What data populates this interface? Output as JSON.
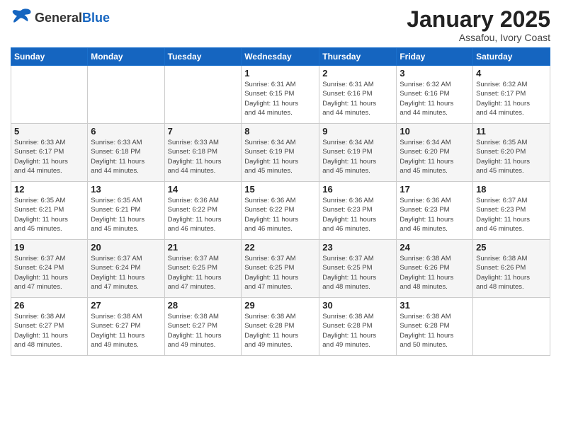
{
  "header": {
    "logo_general": "General",
    "logo_blue": "Blue",
    "month_title": "January 2025",
    "location": "Assafou, Ivory Coast"
  },
  "weekdays": [
    "Sunday",
    "Monday",
    "Tuesday",
    "Wednesday",
    "Thursday",
    "Friday",
    "Saturday"
  ],
  "weeks": [
    [
      {
        "day": "",
        "info": ""
      },
      {
        "day": "",
        "info": ""
      },
      {
        "day": "",
        "info": ""
      },
      {
        "day": "1",
        "info": "Sunrise: 6:31 AM\nSunset: 6:15 PM\nDaylight: 11 hours\nand 44 minutes."
      },
      {
        "day": "2",
        "info": "Sunrise: 6:31 AM\nSunset: 6:16 PM\nDaylight: 11 hours\nand 44 minutes."
      },
      {
        "day": "3",
        "info": "Sunrise: 6:32 AM\nSunset: 6:16 PM\nDaylight: 11 hours\nand 44 minutes."
      },
      {
        "day": "4",
        "info": "Sunrise: 6:32 AM\nSunset: 6:17 PM\nDaylight: 11 hours\nand 44 minutes."
      }
    ],
    [
      {
        "day": "5",
        "info": "Sunrise: 6:33 AM\nSunset: 6:17 PM\nDaylight: 11 hours\nand 44 minutes."
      },
      {
        "day": "6",
        "info": "Sunrise: 6:33 AM\nSunset: 6:18 PM\nDaylight: 11 hours\nand 44 minutes."
      },
      {
        "day": "7",
        "info": "Sunrise: 6:33 AM\nSunset: 6:18 PM\nDaylight: 11 hours\nand 44 minutes."
      },
      {
        "day": "8",
        "info": "Sunrise: 6:34 AM\nSunset: 6:19 PM\nDaylight: 11 hours\nand 45 minutes."
      },
      {
        "day": "9",
        "info": "Sunrise: 6:34 AM\nSunset: 6:19 PM\nDaylight: 11 hours\nand 45 minutes."
      },
      {
        "day": "10",
        "info": "Sunrise: 6:34 AM\nSunset: 6:20 PM\nDaylight: 11 hours\nand 45 minutes."
      },
      {
        "day": "11",
        "info": "Sunrise: 6:35 AM\nSunset: 6:20 PM\nDaylight: 11 hours\nand 45 minutes."
      }
    ],
    [
      {
        "day": "12",
        "info": "Sunrise: 6:35 AM\nSunset: 6:21 PM\nDaylight: 11 hours\nand 45 minutes."
      },
      {
        "day": "13",
        "info": "Sunrise: 6:35 AM\nSunset: 6:21 PM\nDaylight: 11 hours\nand 45 minutes."
      },
      {
        "day": "14",
        "info": "Sunrise: 6:36 AM\nSunset: 6:22 PM\nDaylight: 11 hours\nand 46 minutes."
      },
      {
        "day": "15",
        "info": "Sunrise: 6:36 AM\nSunset: 6:22 PM\nDaylight: 11 hours\nand 46 minutes."
      },
      {
        "day": "16",
        "info": "Sunrise: 6:36 AM\nSunset: 6:23 PM\nDaylight: 11 hours\nand 46 minutes."
      },
      {
        "day": "17",
        "info": "Sunrise: 6:36 AM\nSunset: 6:23 PM\nDaylight: 11 hours\nand 46 minutes."
      },
      {
        "day": "18",
        "info": "Sunrise: 6:37 AM\nSunset: 6:23 PM\nDaylight: 11 hours\nand 46 minutes."
      }
    ],
    [
      {
        "day": "19",
        "info": "Sunrise: 6:37 AM\nSunset: 6:24 PM\nDaylight: 11 hours\nand 47 minutes."
      },
      {
        "day": "20",
        "info": "Sunrise: 6:37 AM\nSunset: 6:24 PM\nDaylight: 11 hours\nand 47 minutes."
      },
      {
        "day": "21",
        "info": "Sunrise: 6:37 AM\nSunset: 6:25 PM\nDaylight: 11 hours\nand 47 minutes."
      },
      {
        "day": "22",
        "info": "Sunrise: 6:37 AM\nSunset: 6:25 PM\nDaylight: 11 hours\nand 47 minutes."
      },
      {
        "day": "23",
        "info": "Sunrise: 6:37 AM\nSunset: 6:25 PM\nDaylight: 11 hours\nand 48 minutes."
      },
      {
        "day": "24",
        "info": "Sunrise: 6:38 AM\nSunset: 6:26 PM\nDaylight: 11 hours\nand 48 minutes."
      },
      {
        "day": "25",
        "info": "Sunrise: 6:38 AM\nSunset: 6:26 PM\nDaylight: 11 hours\nand 48 minutes."
      }
    ],
    [
      {
        "day": "26",
        "info": "Sunrise: 6:38 AM\nSunset: 6:27 PM\nDaylight: 11 hours\nand 48 minutes."
      },
      {
        "day": "27",
        "info": "Sunrise: 6:38 AM\nSunset: 6:27 PM\nDaylight: 11 hours\nand 49 minutes."
      },
      {
        "day": "28",
        "info": "Sunrise: 6:38 AM\nSunset: 6:27 PM\nDaylight: 11 hours\nand 49 minutes."
      },
      {
        "day": "29",
        "info": "Sunrise: 6:38 AM\nSunset: 6:28 PM\nDaylight: 11 hours\nand 49 minutes."
      },
      {
        "day": "30",
        "info": "Sunrise: 6:38 AM\nSunset: 6:28 PM\nDaylight: 11 hours\nand 49 minutes."
      },
      {
        "day": "31",
        "info": "Sunrise: 6:38 AM\nSunset: 6:28 PM\nDaylight: 11 hours\nand 50 minutes."
      },
      {
        "day": "",
        "info": ""
      }
    ]
  ]
}
